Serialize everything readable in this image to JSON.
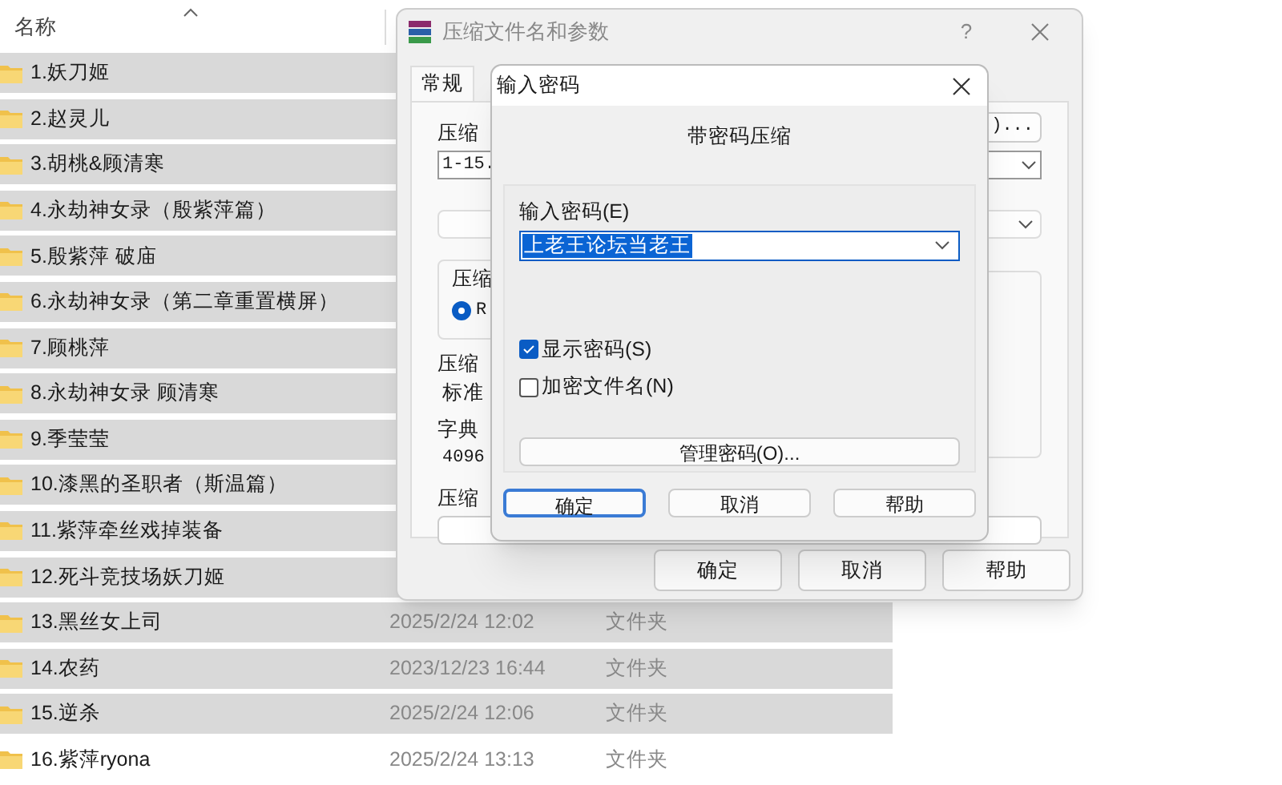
{
  "explorer": {
    "columns": {
      "name": "名称"
    },
    "rows": [
      {
        "name": "1.妖刀姬",
        "selected": true
      },
      {
        "name": "2.赵灵儿",
        "selected": true
      },
      {
        "name": "3.胡桃&顾清寒",
        "selected": true
      },
      {
        "name": "4.永劫神女录（殷紫萍篇）",
        "selected": true
      },
      {
        "name": "5.殷紫萍 破庙",
        "selected": true
      },
      {
        "name": "6.永劫神女录（第二章重置横屏）",
        "selected": true
      },
      {
        "name": "7.顾桃萍",
        "selected": true
      },
      {
        "name": "8.永劫神女录 顾清寒",
        "selected": true
      },
      {
        "name": "9.季莹莹",
        "selected": true
      },
      {
        "name": "10.漆黑的圣职者（斯温篇）",
        "selected": true
      },
      {
        "name": "11.紫萍牵丝戏掉装备",
        "selected": true
      },
      {
        "name": "12.死斗竞技场妖刀姬",
        "selected": true
      },
      {
        "name": "13.黑丝女上司",
        "date": "2025/2/24 12:02",
        "type": "文件夹",
        "selected": true
      },
      {
        "name": "14.农药",
        "date": "2023/12/23 16:44",
        "type": "文件夹",
        "selected": true
      },
      {
        "name": "15.逆杀",
        "date": "2025/2/24 12:06",
        "type": "文件夹",
        "selected": true
      },
      {
        "name": "16.紫萍ryona",
        "date": "2025/2/24 13:13",
        "type": "文件夹",
        "selected": false
      }
    ]
  },
  "archive_dialog": {
    "title": "压缩文件名和参数",
    "help": "?",
    "tabs": [
      {
        "label": "常规",
        "selected": true
      }
    ],
    "archive_name_label": "压缩",
    "browse_button": ")...",
    "archive_name": "1-15.",
    "format_label": "压缩",
    "format_option": {
      "label": "R",
      "checked": true
    },
    "method_label": "压缩",
    "method": "标准",
    "dictionary_label": "字典",
    "dictionary": "4096",
    "split_label": "压缩",
    "buttons": [
      {
        "label": "确定"
      },
      {
        "label": "取消"
      },
      {
        "label": "帮助"
      }
    ]
  },
  "password_dialog": {
    "title": "输入密码",
    "heading": "带密码压缩",
    "password_label": "输入密码(E)",
    "password": "上老王论坛当老王",
    "options": [
      {
        "label": "显示密码(S)",
        "checked": true
      },
      {
        "label": "加密文件名(N)",
        "checked": false
      }
    ],
    "manage_button": "管理密码(O)...",
    "buttons": [
      {
        "label": "确定",
        "focused": true
      },
      {
        "label": "取消",
        "focused": false
      },
      {
        "label": "帮助",
        "focused": false
      }
    ]
  }
}
